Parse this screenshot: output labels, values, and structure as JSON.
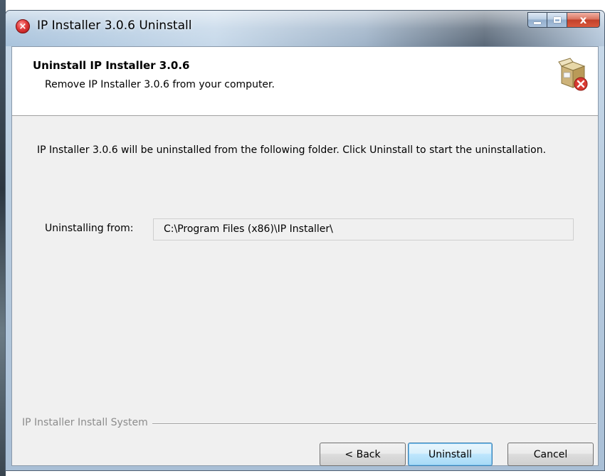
{
  "window": {
    "title": "IP Installer 3.0.6 Uninstall",
    "close_glyph": "x"
  },
  "header": {
    "title": "Uninstall IP Installer 3.0.6",
    "subtitle": "Remove IP Installer 3.0.6 from your computer.",
    "icon": "uninstall-box-icon"
  },
  "body": {
    "description": "IP Installer 3.0.6 will be uninstalled from the following folder. Click Uninstall to start the uninstallation.",
    "from_label": "Uninstalling from:",
    "from_value": "C:\\Program Files (x86)\\IP Installer\\"
  },
  "footer": {
    "branding": "IP Installer Install System",
    "back_label": "< Back",
    "uninstall_label": "Uninstall",
    "cancel_label": "Cancel"
  },
  "colors": {
    "dialog_bg": "#f0f0f0",
    "header_bg": "#ffffff",
    "default_button_border": "#3c7fb1",
    "close_button": "#c2412a"
  }
}
